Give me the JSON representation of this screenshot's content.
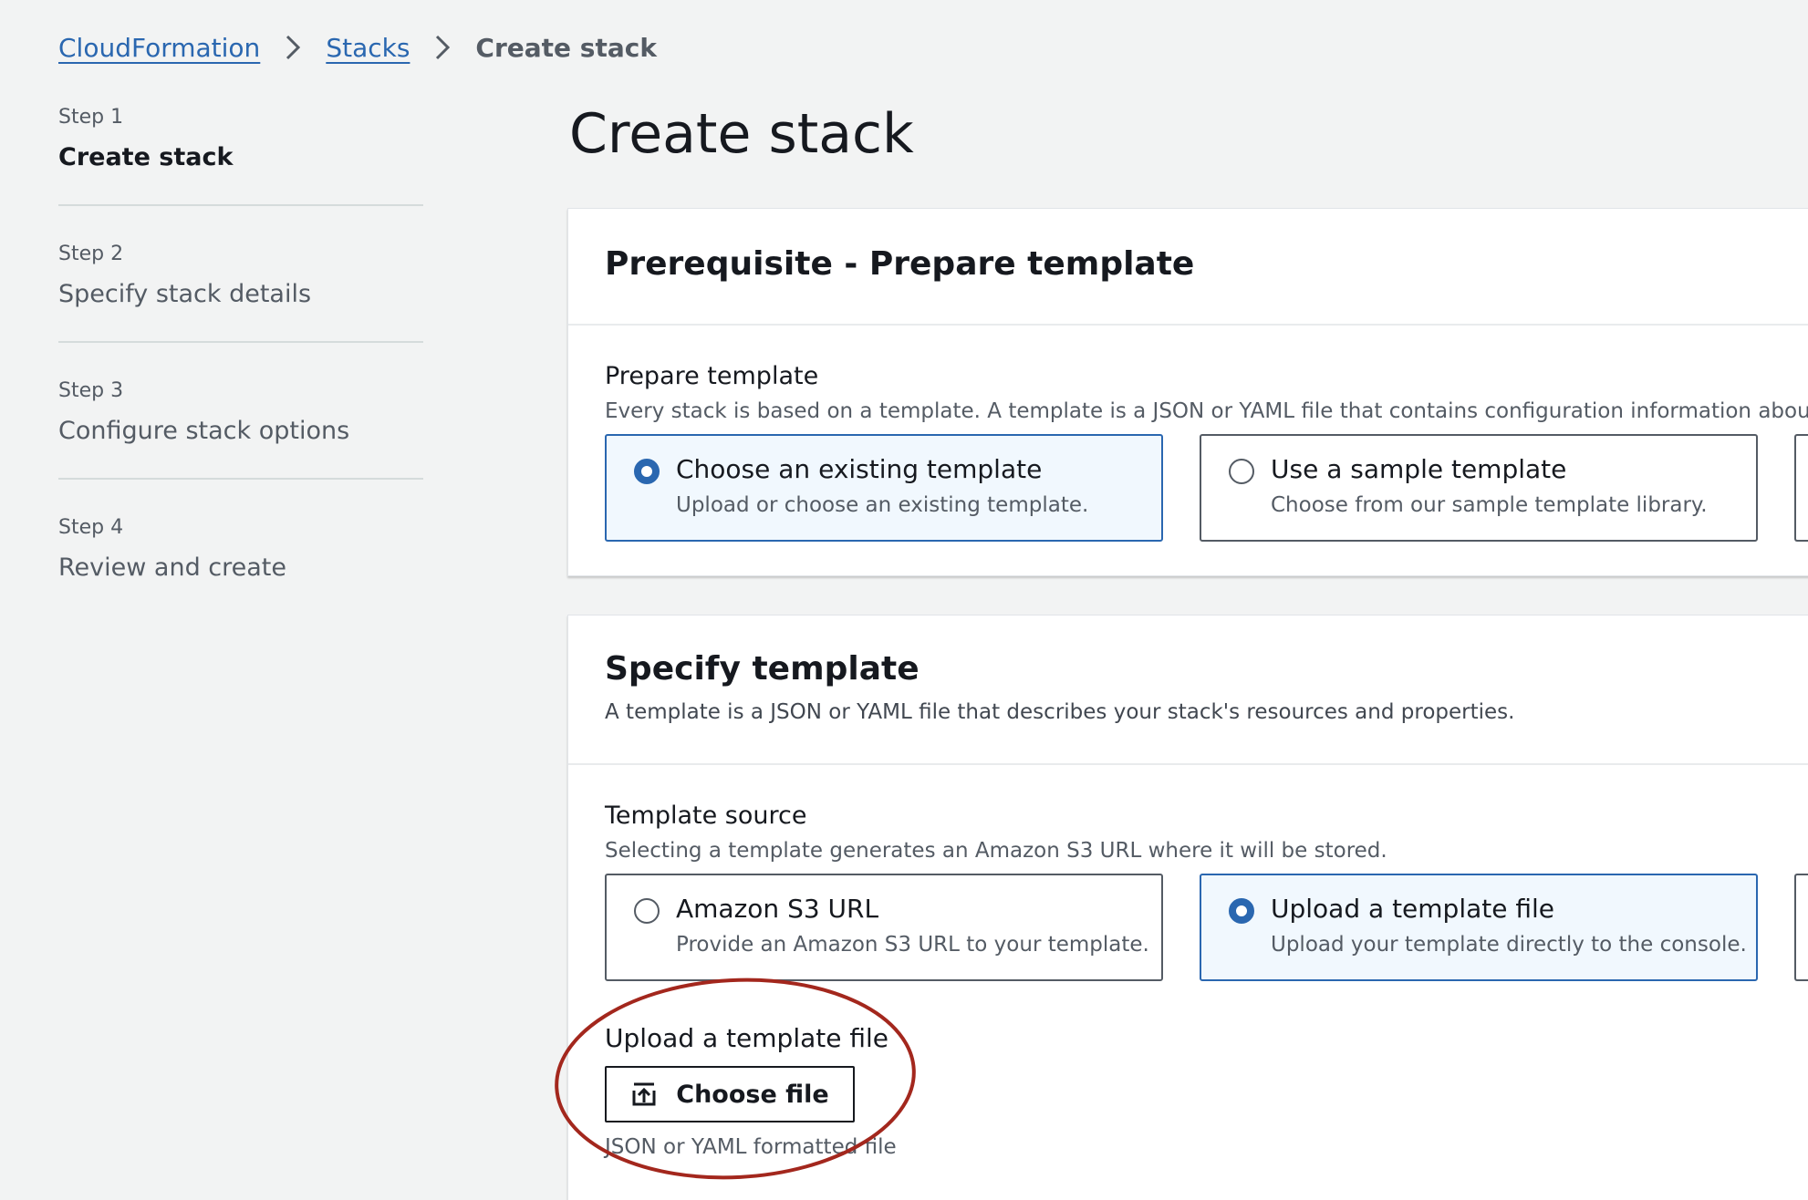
{
  "breadcrumb": {
    "items": [
      "CloudFormation",
      "Stacks"
    ],
    "current": "Create stack"
  },
  "steps": [
    {
      "num": "Step 1",
      "title": "Create stack",
      "active": true
    },
    {
      "num": "Step 2",
      "title": "Specify stack details",
      "active": false
    },
    {
      "num": "Step 3",
      "title": "Configure stack options",
      "active": false
    },
    {
      "num": "Step 4",
      "title": "Review and create",
      "active": false
    }
  ],
  "page_title": "Create stack",
  "prerequisite": {
    "heading": "Prerequisite - Prepare template",
    "field_label": "Prepare template",
    "field_desc": "Every stack is based on a template. A template is a JSON or YAML file that contains configuration information about the A",
    "options": [
      {
        "title": "Choose an existing template",
        "desc": "Upload or choose an existing template.",
        "selected": true
      },
      {
        "title": "Use a sample template",
        "desc": "Choose from our sample template library.",
        "selected": false
      }
    ]
  },
  "specify": {
    "heading": "Specify template",
    "desc": "A template is a JSON or YAML file that describes your stack's resources and properties.",
    "field_label": "Template source",
    "field_desc": "Selecting a template generates an Amazon S3 URL where it will be stored.",
    "options": [
      {
        "title": "Amazon S3 URL",
        "desc": "Provide an Amazon S3 URL to your template.",
        "selected": false
      },
      {
        "title": "Upload a template file",
        "desc": "Upload your template directly to the console.",
        "selected": true
      }
    ],
    "upload_label": "Upload a template file",
    "choose_file": "Choose file",
    "upload_hint": "JSON or YAML formatted file"
  },
  "colors": {
    "link": "#2a67b0",
    "selected_border": "#2a67b0",
    "annotation": "#a3271d"
  },
  "icons": {
    "breadcrumb_separator": "chevron-right-icon",
    "choose_file": "upload-icon"
  }
}
